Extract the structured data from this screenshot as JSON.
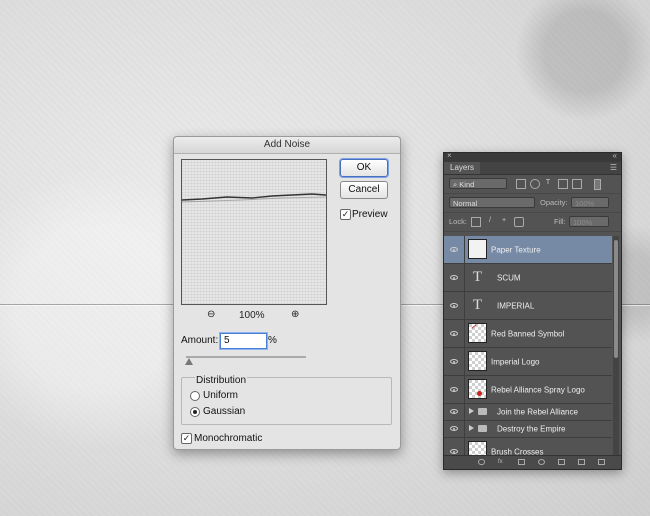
{
  "dialog": {
    "title": "Add Noise",
    "ok_label": "OK",
    "cancel_label": "Cancel",
    "preview_label": "Preview",
    "preview_checked": true,
    "zoom_level": "100%",
    "zoom_out_icon": "⊖",
    "zoom_in_icon": "⊕",
    "amount_label": "Amount:",
    "amount_value": "5",
    "amount_unit": "%",
    "distribution_label": "Distribution",
    "uniform_label": "Uniform",
    "gaussian_label": "Gaussian",
    "selected_distribution": "Gaussian",
    "monochromatic_label": "Monochromatic",
    "monochromatic_checked": true,
    "check_mark": "✓"
  },
  "layers_panel": {
    "close_icon": "×",
    "collapse_icon": "«",
    "tab_label": "Layers",
    "menu_icon": "☰",
    "filter_kind": "Kind",
    "blend_mode": "Normal",
    "opacity_label": "Opacity:",
    "opacity_value": "100%",
    "lock_label": "Lock:",
    "fill_label": "Fill:",
    "fill_value": "100%",
    "selection_color": "#768aa5",
    "layers": [
      {
        "name": "Paper Texture",
        "type": "image",
        "selected": true
      },
      {
        "name": "SCUM",
        "type": "text"
      },
      {
        "name": "IMPERIAL",
        "type": "text"
      },
      {
        "name": "Red Banned Symbol",
        "type": "smart"
      },
      {
        "name": "Imperial Logo",
        "type": "smart"
      },
      {
        "name": "Rebel Alliance Spray Logo",
        "type": "smart"
      },
      {
        "name": "Join the Rebel Alliance",
        "type": "group"
      },
      {
        "name": "Destroy the Empire",
        "type": "group"
      },
      {
        "name": "Brush Crosses",
        "type": "smart"
      }
    ],
    "text_glyph": "T"
  }
}
